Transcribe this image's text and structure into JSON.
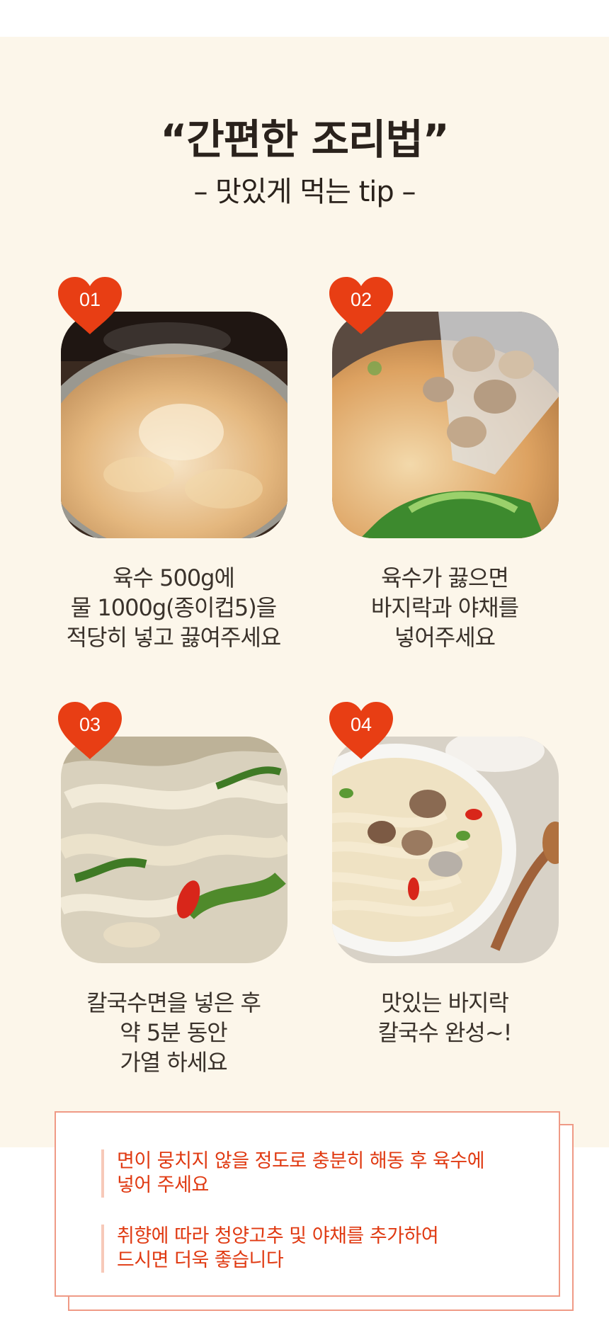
{
  "header": {
    "title": "“간편한 조리법”",
    "subtitle": "– 맛있게 먹는 tip –"
  },
  "colors": {
    "background": "#fcf6ea",
    "accent": "#e83e14",
    "text": "#3a322b",
    "note_text": "#e03a12",
    "note_border": "#ef9a86"
  },
  "steps": [
    {
      "number": "01",
      "photo": "boiling-broth-photo",
      "lines": [
        "육수 500g에",
        "물 1000g(종이컵5)을",
        "적당히 넣고 끓여주세요"
      ]
    },
    {
      "number": "02",
      "photo": "adding-clams-photo",
      "lines": [
        "육수가 끓으면",
        "바지락과 야채를",
        "넣어주세요"
      ]
    },
    {
      "number": "03",
      "photo": "cooking-noodles-photo",
      "lines": [
        "칼국수면을 넣은 후",
        "약 5분 동안",
        "가열 하세요"
      ]
    },
    {
      "number": "04",
      "photo": "finished-kalguksu-photo",
      "lines": [
        "맛있는 바지락",
        "칼국수 완성~!"
      ]
    }
  ],
  "notes": [
    {
      "lines": [
        "면이 뭉치지 않을 정도로 충분히 해동 후 육수에",
        "넣어 주세요"
      ]
    },
    {
      "lines": [
        "취향에 따라 청양고추 및 야채를 추가하여",
        "드시면 더욱 좋습니다"
      ]
    }
  ]
}
